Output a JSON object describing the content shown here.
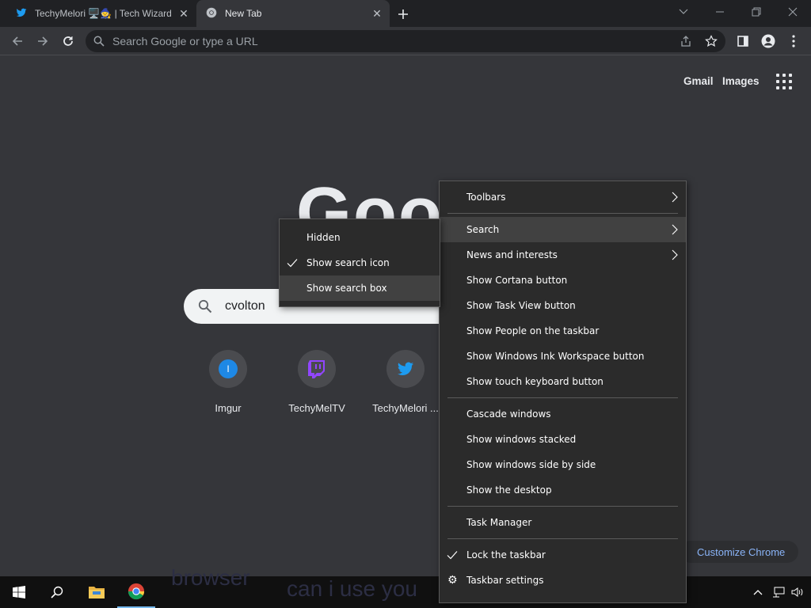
{
  "browser": {
    "tabs": [
      {
        "title": "TechyMelori 🖥️🧙 | Tech Wizard",
        "icon": "twitter-bird-icon"
      },
      {
        "title": "New Tab",
        "icon": "chrome-icon"
      }
    ],
    "omnibox_placeholder": "Search Google or type a URL"
  },
  "page": {
    "topnav": {
      "gmail": "Gmail",
      "images": "Images"
    },
    "logo": "Google",
    "search_query": "cvolton",
    "shortcuts": [
      {
        "label": "Imgur",
        "glyph": "I"
      },
      {
        "label": "TechyMelTV",
        "icon": "twitch-icon"
      },
      {
        "label": "TechyMelori ...",
        "icon": "twitter-bird-icon"
      }
    ],
    "customize_label": "Customize Chrome"
  },
  "context_menu": {
    "items": [
      {
        "label": "Toolbars",
        "submenu": true
      },
      {
        "label": "Search",
        "submenu": true,
        "highlighted": true
      },
      {
        "label": "News and interests",
        "submenu": true
      },
      {
        "label": "Show Cortana button"
      },
      {
        "label": "Show Task View button"
      },
      {
        "label": "Show People on the taskbar"
      },
      {
        "label": "Show Windows Ink Workspace button"
      },
      {
        "label": "Show touch keyboard button"
      },
      {
        "label": "Cascade windows"
      },
      {
        "label": "Show windows stacked"
      },
      {
        "label": "Show windows side by side"
      },
      {
        "label": "Show the desktop"
      },
      {
        "label": "Task Manager"
      },
      {
        "label": "Lock the taskbar",
        "checked": true
      },
      {
        "label": "Taskbar settings",
        "icon": "gear-icon"
      }
    ]
  },
  "search_submenu": {
    "items": [
      {
        "label": "Hidden"
      },
      {
        "label": "Show search icon",
        "checked": true
      },
      {
        "label": "Show search box",
        "highlighted": true
      }
    ]
  },
  "taskbar": {
    "background_text": [
      "browser",
      "can i use you"
    ]
  },
  "colors": {
    "accent": "#8ab4f8",
    "page_bg": "#35363a",
    "titlebar_bg": "#202124",
    "menu_bg": "#2b2b2b",
    "twitch": "#9146ff",
    "twitter": "#1d9bf0",
    "imgur": "#1e88e5"
  }
}
